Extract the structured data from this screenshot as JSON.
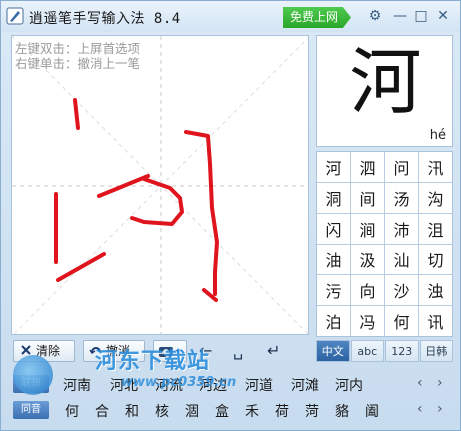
{
  "titlebar": {
    "title": "逍遥笔手写输入法 8.4",
    "free_label": "免费上网",
    "icons": [
      "gear-icon",
      "minimize-icon",
      "maximize-icon",
      "close-icon"
    ]
  },
  "pad": {
    "hint_left_double": "左键双击：上屏首选项",
    "hint_right_single": "右键单击：撤消上一笔"
  },
  "preview": {
    "character": "河",
    "pinyin": "hé"
  },
  "candidates": [
    "河",
    "泗",
    "问",
    "汛",
    "洞",
    "间",
    "汤",
    "沟",
    "闪",
    "涧",
    "沛",
    "沮",
    "油",
    "汲",
    "汕",
    "切",
    "污",
    "向",
    "沙",
    "浊",
    "泊",
    "冯",
    "何",
    "讯"
  ],
  "modes": [
    "中文",
    "abc",
    "123",
    "日韩"
  ],
  "toolbar": {
    "clear_label": "清除",
    "undo_label": "撤消"
  },
  "phrase_row": {
    "tag": "联想",
    "items": [
      "河南",
      "河北",
      "河流",
      "河边",
      "河道",
      "河滩",
      "河内"
    ]
  },
  "homophone_row": {
    "tag": "同音",
    "items": [
      "何",
      "合",
      "和",
      "核",
      "涸",
      "盒",
      "禾",
      "荷",
      "菏",
      "貉",
      "阖"
    ]
  },
  "watermark": {
    "name": "河东下载站",
    "url": "www.pc0359.cn"
  },
  "colors": {
    "stroke": "#e0141c",
    "accent": "#2d62a3",
    "free": "#2aa62a"
  }
}
